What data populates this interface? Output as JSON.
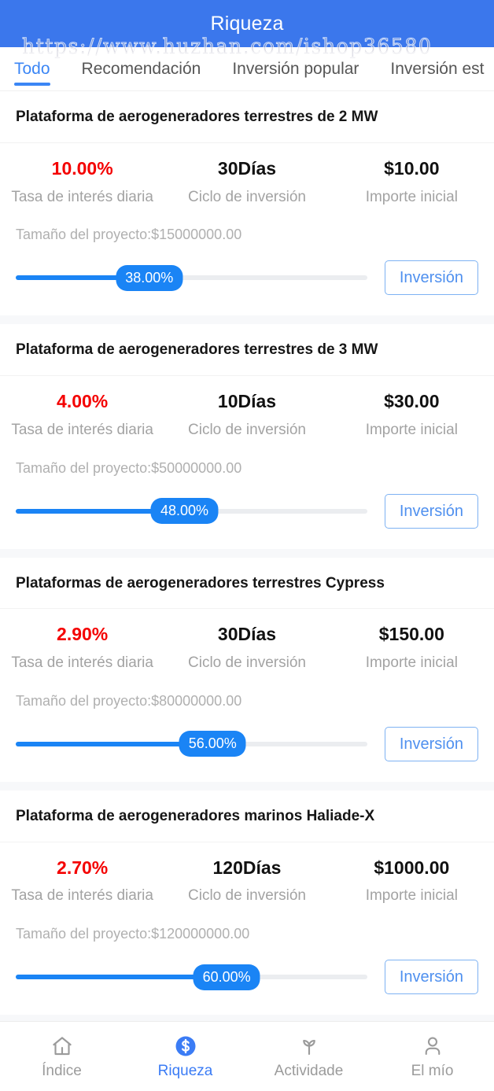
{
  "header": {
    "title": "Riqueza",
    "brand_color": "#3b77ec",
    "watermark": "https://www.huzhan.com/ishop36580"
  },
  "tabs": {
    "active_index": 0,
    "items": [
      {
        "label": "Todo"
      },
      {
        "label": "Recomendación"
      },
      {
        "label": "Inversión popular"
      },
      {
        "label": "Inversión est"
      }
    ]
  },
  "labels": {
    "rate": "Tasa de interés diaria",
    "cycle": "Ciclo de inversión",
    "amount": "Importe inicial",
    "invest_button": "Inversión"
  },
  "colors": {
    "accent": "#1a84f5",
    "rate_red": "#f40000",
    "muted": "#a3a3a3"
  },
  "products": [
    {
      "title": "Plataforma de aerogeneradores terrestres de 2 MW",
      "rate": "10.00%",
      "cycle": "30Días",
      "amount": "$10.00",
      "project_size": "Tamaño del proyecto:$15000000.00",
      "progress": "38.00%",
      "progress_value": 38
    },
    {
      "title": "Plataforma de aerogeneradores terrestres de 3 MW",
      "rate": "4.00%",
      "cycle": "10Días",
      "amount": "$30.00",
      "project_size": "Tamaño del proyecto:$50000000.00",
      "progress": "48.00%",
      "progress_value": 48
    },
    {
      "title": "Plataformas de aerogeneradores terrestres Cypress",
      "rate": "2.90%",
      "cycle": "30Días",
      "amount": "$150.00",
      "project_size": "Tamaño del proyecto:$80000000.00",
      "progress": "56.00%",
      "progress_value": 56
    },
    {
      "title": "Plataforma de aerogeneradores marinos Haliade-X",
      "rate": "2.70%",
      "cycle": "120Días",
      "amount": "$1000.00",
      "project_size": "Tamaño del proyecto:$120000000.00",
      "progress": "60.00%",
      "progress_value": 60
    }
  ],
  "bottom_nav": {
    "active_index": 1,
    "items": [
      {
        "label": "Índice",
        "icon": "home-icon"
      },
      {
        "label": "Riqueza",
        "icon": "dollar-coin-icon"
      },
      {
        "label": "Actividade",
        "icon": "sprout-icon"
      },
      {
        "label": "El mío",
        "icon": "person-icon"
      }
    ]
  }
}
